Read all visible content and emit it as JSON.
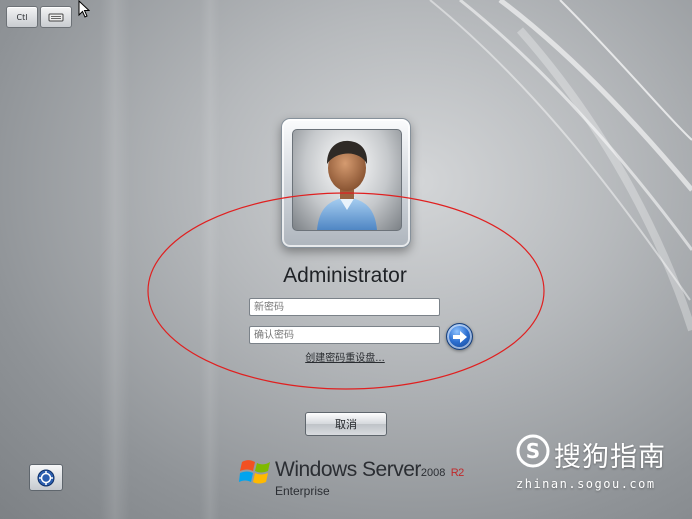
{
  "toolbar": {
    "ctrl_alt_del_label": "Ctl"
  },
  "login": {
    "username": "Administrator",
    "new_password_placeholder": "新密码",
    "confirm_password_placeholder": "确认密码",
    "reset_disk_link": "创建密码重设盘..."
  },
  "buttons": {
    "cancel_label": "取消"
  },
  "brand": {
    "name": "Windows Server",
    "version": "2008",
    "release": "R2",
    "edition": "Enterprise"
  },
  "watermark": {
    "name": "搜狗指南",
    "domain": "zhinan.sogou.com"
  },
  "colors": {
    "background": "#a9adb1",
    "annotation_ellipse": "#e02020",
    "go_button": "#2d6fd0",
    "brand_release": "#c0292b"
  },
  "icons": {
    "keyboard": "keyboard-icon",
    "cursor": "mouse-cursor-icon",
    "avatar": "user-avatar-icon",
    "go": "arrow-right-icon",
    "accessibility": "ease-of-access-icon",
    "windows_logo": "windows-flag-icon",
    "sogou_logo": "sogou-logo-icon"
  }
}
